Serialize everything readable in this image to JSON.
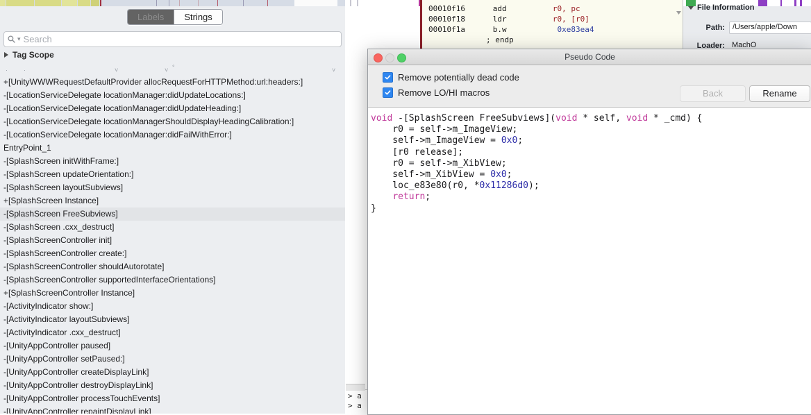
{
  "sidebar": {
    "tabs": [
      {
        "label": "Labels",
        "selected": true
      },
      {
        "label": "Strings",
        "selected": false
      }
    ],
    "search": {
      "placeholder": "Search",
      "value": "",
      "icon": "search-icon"
    },
    "tag_scope": {
      "label": "Tag Scope",
      "expanded": false,
      "icon": "disclosure-triangle-right-icon"
    },
    "selected_item": "-[SplashScreen FreeSubviews]",
    "items": [
      "+[UnityWWWRequestDefaultProvider allocRequestForHTTPMethod:url:headers:]",
      "-[LocationServiceDelegate locationManager:didUpdateLocations:]",
      "-[LocationServiceDelegate locationManager:didUpdateHeading:]",
      "-[LocationServiceDelegate locationManagerShouldDisplayHeadingCalibration:]",
      "-[LocationServiceDelegate locationManager:didFailWithError:]",
      "EntryPoint_1",
      "-[SplashScreen initWithFrame:]",
      "-[SplashScreen updateOrientation:]",
      "-[SplashScreen layoutSubviews]",
      "+[SplashScreen Instance]",
      "-[SplashScreen FreeSubviews]",
      "-[SplashScreen .cxx_destruct]",
      "-[SplashScreenController init]",
      "-[SplashScreenController create:]",
      "-[SplashScreenController shouldAutorotate]",
      "-[SplashScreenController supportedInterfaceOrientations]",
      "+[SplashScreenController Instance]",
      "-[ActivityIndicator show:]",
      "-[ActivityIndicator layoutSubviews]",
      "-[ActivityIndicator .cxx_destruct]",
      "-[UnityAppController paused]",
      "-[UnityAppController setPaused:]",
      "-[UnityAppController createDisplayLink]",
      "-[UnityAppController destroyDisplayLink]",
      "-[UnityAppController processTouchEvents]",
      "-[UnityAppController repaintDisplayLink]"
    ]
  },
  "disassembly": {
    "lines": [
      {
        "address": "00010f16",
        "mnemonic": "add",
        "operands": "r0, pc",
        "target": ""
      },
      {
        "address": "00010f18",
        "mnemonic": "ldr",
        "operands": "r0, [r0]",
        "target": ""
      },
      {
        "address": "00010f1a",
        "mnemonic": "b.w",
        "operands": "",
        "target": "0xe83ea4"
      }
    ],
    "comment": "; endp"
  },
  "console": {
    "prompt_lines": [
      "> a",
      "> a"
    ]
  },
  "inspector": {
    "title": "File Information",
    "rows": [
      {
        "label": "Path:",
        "value": "/Users/apple/Down"
      },
      {
        "label": "Loader:",
        "value": "MachO"
      }
    ]
  },
  "dialog": {
    "title": "Pseudo Code",
    "window_controls": [
      "close-button",
      "minimize-button",
      "zoom-button"
    ],
    "options": [
      {
        "label": "Remove potentially dead code",
        "checked": true
      },
      {
        "label": "Remove LO/HI macros",
        "checked": true
      }
    ],
    "buttons": [
      {
        "label": "Back",
        "enabled": false
      },
      {
        "label": "Rename",
        "enabled": true
      }
    ],
    "code": {
      "signature_prefix": "void",
      "function_name": "-[SplashScreen FreeSubviews]",
      "lines": [
        "void -[SplashScreen FreeSubviews](void * self, void * _cmd) {",
        "    r0 = self->m_ImageView;",
        "    self->m_ImageView = 0x0;",
        "    [r0 release];",
        "    r0 = self->m_XibView;",
        "    self->m_XibView = 0x0;",
        "    loc_e83e80(r0, *0x11286d0);",
        "    return;",
        "}"
      ]
    }
  },
  "colors": {
    "keyword": "#c0399a",
    "number": "#2c2ca8",
    "plain": "#1b1b1d",
    "checkbox_accent": "#2e86f0",
    "selection": "#e2e4e7",
    "asm_operand": "#9b2226",
    "asm_address": "#2f3fa0",
    "asm_comment": "#4e6a9a"
  }
}
